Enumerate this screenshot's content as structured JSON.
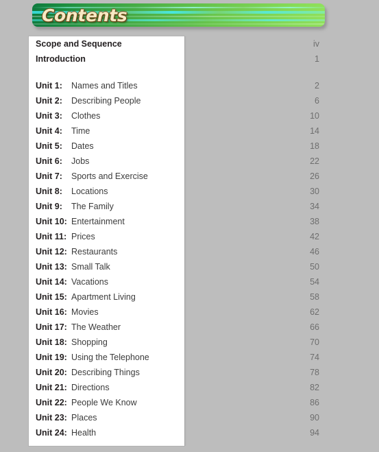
{
  "header": {
    "title": "Contents",
    "banner_color_left": "#0f7a3d",
    "banner_color_right": "#90e05c",
    "title_color": "#f7e9c4",
    "title_outline_color": "#6b4a17"
  },
  "page": {
    "background_color": "#bdbdbd",
    "panel_color": "#ffffff"
  },
  "toc": {
    "front_matter": [
      {
        "title": "Scope and Sequence",
        "page": "iv"
      },
      {
        "title": "Introduction",
        "page": "1"
      }
    ],
    "units": [
      {
        "label": "Unit 1:",
        "title": "Names and Titles",
        "page": "2"
      },
      {
        "label": "Unit 2:",
        "title": "Describing People",
        "page": "6"
      },
      {
        "label": "Unit 3:",
        "title": "Clothes",
        "page": "10"
      },
      {
        "label": "Unit 4:",
        "title": "Time",
        "page": "14"
      },
      {
        "label": "Unit 5:",
        "title": "Dates",
        "page": "18"
      },
      {
        "label": "Unit 6:",
        "title": "Jobs",
        "page": "22"
      },
      {
        "label": "Unit 7:",
        "title": "Sports and Exercise",
        "page": "26"
      },
      {
        "label": "Unit 8:",
        "title": "Locations",
        "page": "30"
      },
      {
        "label": "Unit 9:",
        "title": "The Family",
        "page": "34"
      },
      {
        "label": "Unit 10:",
        "title": "Entertainment",
        "page": "38"
      },
      {
        "label": "Unit 11:",
        "title": "Prices",
        "page": "42"
      },
      {
        "label": "Unit 12:",
        "title": "Restaurants",
        "page": "46"
      },
      {
        "label": "Unit 13:",
        "title": "Small Talk",
        "page": "50"
      },
      {
        "label": "Unit 14:",
        "title": "Vacations",
        "page": "54"
      },
      {
        "label": "Unit 15:",
        "title": "Apartment Living",
        "page": "58"
      },
      {
        "label": "Unit 16:",
        "title": "Movies",
        "page": "62"
      },
      {
        "label": "Unit 17:",
        "title": "The Weather",
        "page": "66"
      },
      {
        "label": "Unit 18:",
        "title": "Shopping",
        "page": "70"
      },
      {
        "label": "Unit 19:",
        "title": "Using the Telephone",
        "page": "74"
      },
      {
        "label": "Unit 20:",
        "title": "Describing Things",
        "page": "78"
      },
      {
        "label": "Unit 21:",
        "title": "Directions",
        "page": "82"
      },
      {
        "label": "Unit 22:",
        "title": "People We Know",
        "page": "86"
      },
      {
        "label": "Unit 23:",
        "title": "Places",
        "page": "90"
      },
      {
        "label": "Unit 24:",
        "title": "Health",
        "page": "94"
      }
    ]
  }
}
